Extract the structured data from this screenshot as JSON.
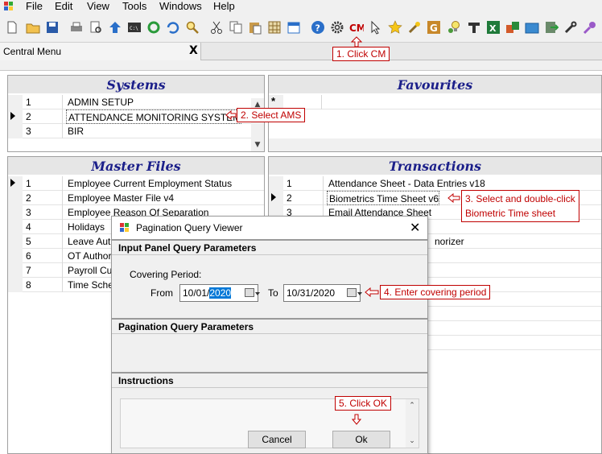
{
  "menubar": {
    "items": [
      "File",
      "Edit",
      "View",
      "Tools",
      "Windows",
      "Help"
    ]
  },
  "toolbar": {
    "icons": [
      "new-icon",
      "open-folder-icon",
      "save-icon",
      "print-icon",
      "print-preview-icon",
      "up-arrow-icon",
      "console-icon",
      "refresh-icon",
      "undo-icon",
      "search-icon",
      "cut-icon",
      "copy-icon",
      "paste-icon",
      "grid-icon",
      "calendar-icon",
      "help-icon",
      "settings-icon",
      "cm-icon",
      "cursor-icon",
      "star-icon",
      "tools-icon",
      "g-icon",
      "bulb-icon",
      "stamp-icon",
      "excel-icon",
      "import-icon",
      "folder-icon",
      "export-icon",
      "wrench-icon",
      "key-icon"
    ],
    "cm_label": "CM"
  },
  "tabs": [
    {
      "label": "Central Menu",
      "close": "X"
    }
  ],
  "systems": {
    "title": "Systems",
    "rows": [
      {
        "num": "1",
        "name": "ADMIN SETUP"
      },
      {
        "num": "2",
        "name": "ATTENDANCE MONITORING SYSTEM"
      },
      {
        "num": "3",
        "name": "BIR"
      }
    ]
  },
  "favourites": {
    "title": "Favourites",
    "new_row_marker": "*"
  },
  "master_files": {
    "title": "Master Files",
    "rows": [
      {
        "num": "1",
        "name": "Employee Current Employment Status"
      },
      {
        "num": "2",
        "name": "Employee Master File v4"
      },
      {
        "num": "3",
        "name": "Employee Reason Of Separation"
      },
      {
        "num": "4",
        "name": "Holidays"
      },
      {
        "num": "5",
        "name": "Leave Auth"
      },
      {
        "num": "6",
        "name": "OT Authoriz"
      },
      {
        "num": "7",
        "name": "Payroll Cust"
      },
      {
        "num": "8",
        "name": "Time Sched"
      }
    ]
  },
  "transactions": {
    "title": "Transactions",
    "rows": [
      {
        "num": "1",
        "name": "Attendance Sheet - Data Entries v18"
      },
      {
        "num": "2",
        "name": "Biometrics Time Sheet v6"
      },
      {
        "num": "3",
        "name": "Email Attendance Sheet"
      }
    ],
    "partial_text": "norizer"
  },
  "dialog": {
    "title": "Pagination Query Viewer",
    "close": "✕",
    "section_input": "Input Panel Query Parameters",
    "covering_period_label": "Covering Period:",
    "from_label": "From",
    "from_value_prefix": "10/01/",
    "from_value_selected": "2020",
    "to_label": "To",
    "to_value": "10/31/2020",
    "section_pagination": "Pagination Query Parameters",
    "section_instructions": "Instructions",
    "cancel_label": "Cancel",
    "ok_label": "Ok"
  },
  "callouts": {
    "step1": "1. Click CM",
    "step2": "2. Select AMS",
    "step3_line1": "3. Select and double-click",
    "step3_line2": "Biometric Time sheet",
    "step4": "4. Enter covering period",
    "step5": "5. Click OK"
  },
  "colors": {
    "panel_title": "#1b1f8a",
    "callout": "#c00000",
    "selection": "#0078d7"
  }
}
